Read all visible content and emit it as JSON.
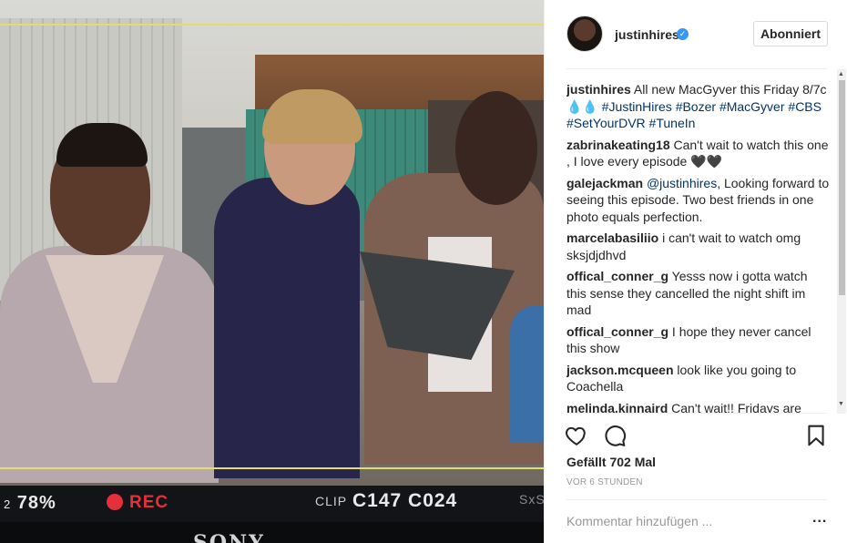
{
  "photo": {
    "hud": {
      "battery": "78%",
      "battery_prefix": "2",
      "rec": "REC",
      "clip_label": "CLIP",
      "clip_value": "C147 C024",
      "right_label": "SxS"
    },
    "brand": "SONY"
  },
  "header": {
    "username": "justinhires",
    "verified_icon": "✓",
    "follow_label": "Abonniert"
  },
  "comments": [
    {
      "user": "justinhires",
      "parts": [
        {
          "text": "All new MacGyver this Friday 8/7c💧💧 ",
          "tag": false
        },
        {
          "text": "#JustinHires",
          "tag": true
        },
        {
          "text": " ",
          "tag": false
        },
        {
          "text": "#Bozer",
          "tag": true
        },
        {
          "text": " ",
          "tag": false
        },
        {
          "text": "#MacGyver",
          "tag": true
        },
        {
          "text": " ",
          "tag": false
        },
        {
          "text": "#CBS",
          "tag": true
        },
        {
          "text": " ",
          "tag": false
        },
        {
          "text": "#SetYourDVR",
          "tag": true
        },
        {
          "text": " ",
          "tag": false
        },
        {
          "text": "#TuneIn",
          "tag": true
        }
      ]
    },
    {
      "user": "zabrinakeating18",
      "parts": [
        {
          "text": "Can't wait to watch this one , I love every episode 🖤🖤",
          "tag": false
        }
      ]
    },
    {
      "user": "galejackman",
      "parts": [
        {
          "text": "@justinhires",
          "tag": true
        },
        {
          "text": ", Looking forward to seeing this episode. Two best friends in one photo equals perfection.",
          "tag": false
        }
      ]
    },
    {
      "user": "marcelabasiliio",
      "parts": [
        {
          "text": "i can't wait to watch omg sksjdjdhvd",
          "tag": false
        }
      ]
    },
    {
      "user": "offical_conner_g",
      "parts": [
        {
          "text": "Yesss now i gotta watch this sense they cancelled the night shift im mad",
          "tag": false
        }
      ]
    },
    {
      "user": "offical_conner_g",
      "parts": [
        {
          "text": "I hope they never cancel this show",
          "tag": false
        }
      ]
    },
    {
      "user": "jackson.mcqueen",
      "parts": [
        {
          "text": "look like you going to Coachella",
          "tag": false
        }
      ]
    },
    {
      "user": "melinda.kinnaird",
      "parts": [
        {
          "text": "Can't wait!! Fridays are",
          "tag": false
        }
      ]
    }
  ],
  "actions": {
    "like_icon": "heart-icon",
    "comment_icon": "comment-icon",
    "save_icon": "bookmark-icon"
  },
  "likes": "Gefällt 702 Mal",
  "timestamp": "VOR 6 STUNDEN",
  "comment_box": {
    "placeholder": "Kommentar hinzufügen ...",
    "more_label": "..."
  },
  "colors": {
    "link": "#003569",
    "verified": "#3897f0",
    "rec": "#e4303b"
  }
}
